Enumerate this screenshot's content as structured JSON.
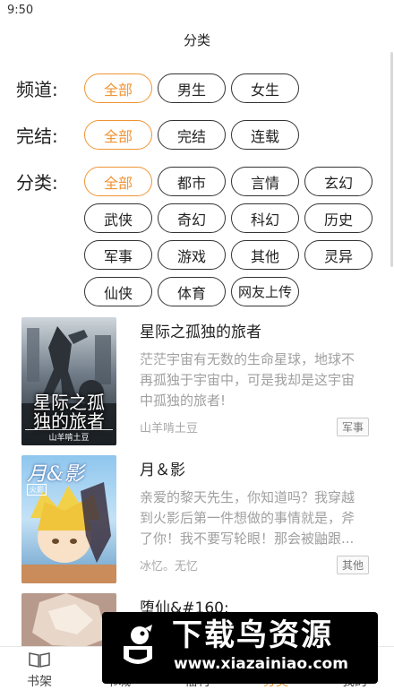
{
  "status_bar": {
    "time": "9:50"
  },
  "nav": {
    "title": "分类"
  },
  "filters": {
    "channel": {
      "label": "频道:",
      "options": [
        "全部",
        "男生",
        "女生"
      ]
    },
    "status": {
      "label": "完结:",
      "options": [
        "全部",
        "完结",
        "连载"
      ]
    },
    "category": {
      "label": "分类:",
      "options": [
        "全部",
        "都市",
        "言情",
        "玄幻",
        "武侠",
        "奇幻",
        "科幻",
        "历史",
        "军事",
        "游戏",
        "其他",
        "灵异",
        "仙侠",
        "体育",
        "网友上传"
      ]
    }
  },
  "books": [
    {
      "title": "星际之孤独的旅者",
      "desc_lines": [
        "茫茫宇宙有无数的生命星球，地球不",
        "再孤独于宇宙中，可是我却是这宇宙",
        "中孤独的旅者!"
      ],
      "author": "山羊啃土豆",
      "category": "军事",
      "cover_title": "星际之孤独的旅者",
      "cover_sub": "山羊啃土豆"
    },
    {
      "title": "月＆影",
      "desc_lines": [
        "亲爱的黎天先生，你知道吗？我穿越",
        "到火影后第一件想做的事情就是，斧",
        "了你！我不要写轮眼！那会被鼬跟..."
      ],
      "author": "冰忆。无忆",
      "category": "其他",
      "cover_title": "月&影",
      "cover_tag": "火影"
    },
    {
      "title": "堕仙&#160;"
    }
  ],
  "tabs": [
    {
      "label": "书架",
      "icon": "book-open-icon"
    },
    {
      "label": "书城",
      "icon": "store-icon"
    },
    {
      "label": "福利",
      "icon": "gift-icon"
    },
    {
      "label": "分类",
      "icon": "category-icon"
    },
    {
      "label": "我的",
      "icon": "user-icon"
    }
  ],
  "watermark": {
    "text": "下载鸟资源",
    "url": "www.xiazainiao.com"
  },
  "colors": {
    "accent": "#f09433",
    "chip_border": "#333333",
    "muted_text": "#a0a0a0"
  }
}
